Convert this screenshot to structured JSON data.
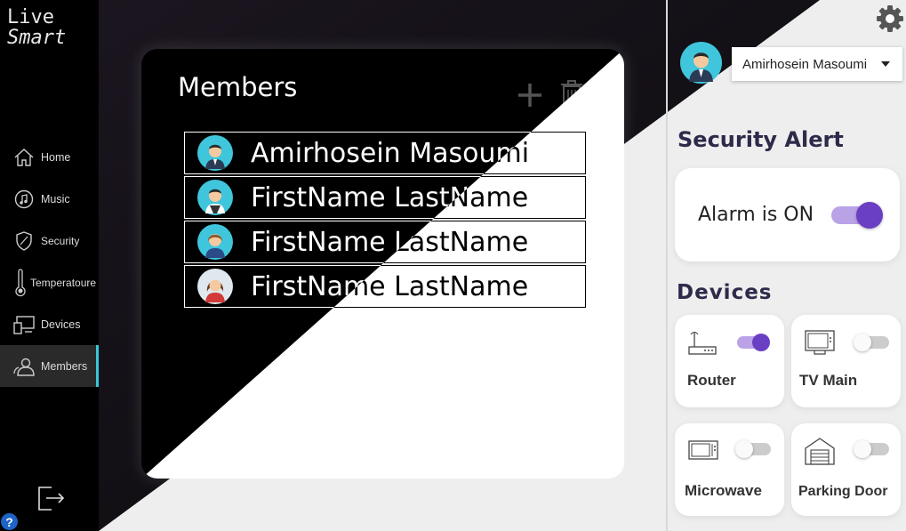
{
  "app": {
    "logo_line1": "Live",
    "logo_line2": "Smart"
  },
  "sidebar": {
    "items": [
      {
        "label": "Home",
        "icon": "home-icon"
      },
      {
        "label": "Music",
        "icon": "music-icon"
      },
      {
        "label": "Security",
        "icon": "shield-icon"
      },
      {
        "label": "Temperatoure",
        "icon": "thermometer-icon"
      },
      {
        "label": "Devices",
        "icon": "devices-icon"
      },
      {
        "label": "Members",
        "icon": "members-icon",
        "active": true
      }
    ],
    "logout_icon": "logout-icon",
    "help_label": "?"
  },
  "members": {
    "title": "Members",
    "list": [
      {
        "name": "Amirhosein Masoumi",
        "avatar": "man-suit-avatar"
      },
      {
        "name": "FirstName LastName",
        "avatar": "man-vest-avatar"
      },
      {
        "name": "FirstName LastName",
        "avatar": "woman-avatar"
      },
      {
        "name": "FirstName LastName",
        "avatar": "woman-red-avatar"
      }
    ]
  },
  "header": {
    "user_name": "Amirhosein Masoumi"
  },
  "security": {
    "title": "Security Alert",
    "alarm_label": "Alarm is ON",
    "alarm_on": true
  },
  "devices": {
    "title": "Devices",
    "items": [
      {
        "label": "Router",
        "icon": "router-icon",
        "on": true
      },
      {
        "label": "TV Main",
        "icon": "tv-icon",
        "on": false
      },
      {
        "label": "Microwave",
        "icon": "microwave-icon",
        "on": false
      },
      {
        "label": "Parking Door",
        "icon": "garage-icon",
        "on": false
      }
    ]
  },
  "colors": {
    "accent": "#6a3fc4",
    "accent_light": "#b9a2e6",
    "active_bar": "#38c6d8",
    "panel_bg": "#eeeeee"
  }
}
